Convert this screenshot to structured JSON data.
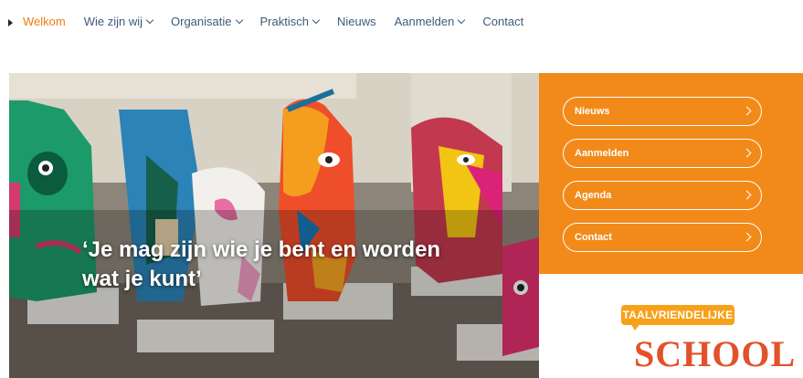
{
  "nav": {
    "items": [
      {
        "label": "Welkom",
        "active": true,
        "dropdown": false
      },
      {
        "label": "Wie zijn wij",
        "active": false,
        "dropdown": true
      },
      {
        "label": "Organisatie",
        "active": false,
        "dropdown": true
      },
      {
        "label": "Praktisch",
        "active": false,
        "dropdown": true
      },
      {
        "label": "Nieuws",
        "active": false,
        "dropdown": false
      },
      {
        "label": "Aanmelden",
        "active": false,
        "dropdown": true
      },
      {
        "label": "Contact",
        "active": false,
        "dropdown": false
      }
    ]
  },
  "hero": {
    "quote_line1": "‘Je mag zijn wie je bent en worden",
    "quote_line2": "wat je kunt’"
  },
  "side_panel": {
    "buttons": [
      {
        "label": "Nieuws"
      },
      {
        "label": "Aanmelden"
      },
      {
        "label": "Agenda"
      },
      {
        "label": "Contact"
      }
    ]
  },
  "logo": {
    "top_text": "TAALVRIENDELIJKE",
    "bottom_text": "SCHOOL"
  },
  "colors": {
    "accent": "#f28a1a",
    "nav_active": "#ee7d11",
    "nav_text": "#3c5a7a"
  }
}
